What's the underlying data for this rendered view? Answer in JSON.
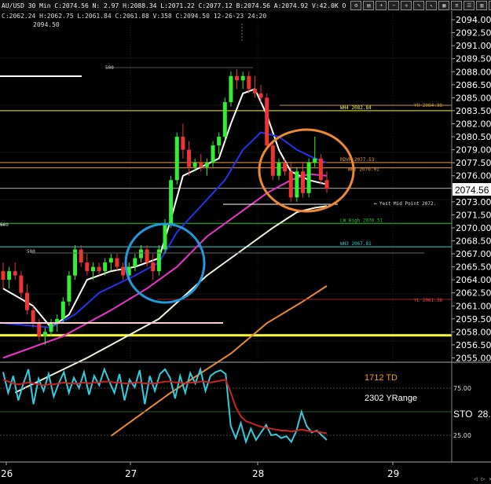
{
  "header": {
    "info": "AU/USD 30 Min C:2074.56 N: 2.97 H:2088.34 L:2071.22 C:2077.12 B:2074.56 A:2074.92 V:42.0K O",
    "subinfo": "C:2062.24 H:2062.75 L:2061.84 C:2061.88 V:358 C:2094.50 12-26-23 24:20",
    "sub_value": "2094.50",
    "icons": [
      "settings-icon",
      "chart-type-icon",
      "zoom-in-icon",
      "zoom-out-icon",
      "crosshair-icon",
      "draw-icon",
      "cursor-icon",
      "grid-icon",
      "config-icon",
      "list-icon",
      "layout-icon",
      "window-icon"
    ]
  },
  "chart_data": [
    {
      "type": "candlestick",
      "ylim": [
        2054.5,
        2095.0
      ],
      "y_ticks": [
        "2094.00",
        "2092.50",
        "2091.00",
        "2089.50",
        "2088.00",
        "2086.50",
        "2085.00",
        "2083.50",
        "2082.00",
        "2080.50",
        "2079.00",
        "2077.50",
        "2076.00",
        "2074.56",
        "2073.00",
        "2071.50",
        "2070.00",
        "2068.50",
        "2067.00",
        "2065.50",
        "2064.00",
        "2062.50",
        "2061.00",
        "2059.50",
        "2058.00",
        "2056.50",
        "2055.00"
      ],
      "last_price": "2074.56",
      "x_ticks": [
        "26",
        "27",
        "28",
        "29"
      ],
      "candles": [
        [
          2065,
          2066,
          2063,
          2064
        ],
        [
          2064,
          2065.5,
          2063,
          2065
        ],
        [
          2065,
          2066,
          2064,
          2064.5
        ],
        [
          2064.5,
          2065,
          2062,
          2062.5
        ],
        [
          2062.5,
          2063.5,
          2060,
          2060.5
        ],
        [
          2060.5,
          2061,
          2058.5,
          2059
        ],
        [
          2059,
          2059.5,
          2057,
          2057.5
        ],
        [
          2057.5,
          2058.5,
          2056.5,
          2058
        ],
        [
          2058,
          2059.5,
          2057.5,
          2059
        ],
        [
          2059,
          2060,
          2058,
          2059.5
        ],
        [
          2059.5,
          2062,
          2059,
          2061.5
        ],
        [
          2061.5,
          2065,
          2061,
          2064.5
        ],
        [
          2064.5,
          2068,
          2064,
          2067.5
        ],
        [
          2067.5,
          2068,
          2065.5,
          2066
        ],
        [
          2066,
          2067,
          2064.5,
          2065
        ],
        [
          2065,
          2066,
          2064,
          2065.5
        ],
        [
          2065.5,
          2066,
          2064.5,
          2065
        ],
        [
          2065,
          2066.5,
          2064.5,
          2066
        ],
        [
          2066,
          2067,
          2065,
          2066.5
        ],
        [
          2066.5,
          2067,
          2065,
          2065.5
        ],
        [
          2065.5,
          2066,
          2064,
          2064.5
        ],
        [
          2064.5,
          2066,
          2064,
          2065.5
        ],
        [
          2065.5,
          2067,
          2065,
          2066.5
        ],
        [
          2066.5,
          2068,
          2066,
          2067.5
        ],
        [
          2067.5,
          2068,
          2065.5,
          2066
        ],
        [
          2066,
          2067,
          2064,
          2065
        ],
        [
          2065,
          2068,
          2064.5,
          2067.5
        ],
        [
          2067.5,
          2071,
          2067,
          2070.5
        ],
        [
          2070.5,
          2076,
          2070,
          2075.5
        ],
        [
          2075.5,
          2081,
          2075,
          2080.5
        ],
        [
          2080.5,
          2082,
          2078,
          2079
        ],
        [
          2079,
          2080,
          2076,
          2077
        ],
        [
          2077,
          2078,
          2076.5,
          2077.5
        ],
        [
          2077.5,
          2078.5,
          2076.5,
          2077
        ],
        [
          2077,
          2078,
          2076,
          2077.5
        ],
        [
          2077.5,
          2080,
          2077,
          2079.5
        ],
        [
          2079.5,
          2081,
          2078.5,
          2080.5
        ],
        [
          2080.5,
          2085,
          2080,
          2084.5
        ],
        [
          2084.5,
          2088,
          2084,
          2087.5
        ],
        [
          2087.5,
          2088.3,
          2086,
          2087
        ],
        [
          2087,
          2088,
          2086,
          2087.5
        ],
        [
          2087.5,
          2088,
          2085.5,
          2086
        ],
        [
          2086,
          2087.5,
          2085,
          2085.5
        ],
        [
          2085.5,
          2086.5,
          2084.5,
          2085
        ],
        [
          2085,
          2085.5,
          2079,
          2079.5
        ],
        [
          2079.5,
          2080,
          2075.5,
          2076
        ],
        [
          2076,
          2078,
          2075.5,
          2077.5
        ],
        [
          2077.5,
          2078,
          2076,
          2076.5
        ],
        [
          2076.5,
          2077.5,
          2073,
          2073.5
        ],
        [
          2073.5,
          2077,
          2073,
          2076.5
        ],
        [
          2076.5,
          2077.5,
          2073.5,
          2074
        ],
        [
          2074,
          2078,
          2073.5,
          2077.5
        ],
        [
          2077.5,
          2080.5,
          2077,
          2078
        ],
        [
          2078,
          2078.5,
          2075,
          2075.5
        ],
        [
          2075.5,
          2076.5,
          2074,
          2074.5
        ]
      ],
      "ma_lines": [
        {
          "color": "#ffffff",
          "points": [
            [
              0,
              2063
            ],
            [
              5,
              2061
            ],
            [
              8,
              2058.5
            ],
            [
              11,
              2060
            ],
            [
              14,
              2064
            ],
            [
              18,
              2065
            ],
            [
              22,
              2065.5
            ],
            [
              26,
              2066.5
            ],
            [
              28,
              2071
            ],
            [
              30,
              2076
            ],
            [
              33,
              2077
            ],
            [
              36,
              2078
            ],
            [
              38,
              2082
            ],
            [
              40,
              2085.5
            ],
            [
              42,
              2086
            ],
            [
              44,
              2083
            ],
            [
              46,
              2079
            ],
            [
              48,
              2076.5
            ],
            [
              51,
              2075.5
            ],
            [
              54,
              2075
            ]
          ]
        },
        {
          "color": "#2233ee",
          "points": [
            [
              0,
              2059
            ],
            [
              8,
              2058.5
            ],
            [
              12,
              2060
            ],
            [
              16,
              2062.5
            ],
            [
              22,
              2064.5
            ],
            [
              26,
              2066
            ],
            [
              29,
              2069.5
            ],
            [
              33,
              2072.5
            ],
            [
              37,
              2075.5
            ],
            [
              40,
              2079
            ],
            [
              43,
              2081
            ],
            [
              46,
              2080.5
            ],
            [
              49,
              2079
            ],
            [
              52,
              2078
            ],
            [
              54,
              2077.5
            ]
          ]
        },
        {
          "color": "#ee33cc",
          "points": [
            [
              0,
              2055
            ],
            [
              10,
              2057.5
            ],
            [
              18,
              2060.5
            ],
            [
              24,
              2063
            ],
            [
              29,
              2065.5
            ],
            [
              34,
              2069
            ],
            [
              39,
              2071.5
            ],
            [
              44,
              2074
            ],
            [
              48,
              2075.5
            ],
            [
              51,
              2076.2
            ],
            [
              54,
              2076
            ]
          ]
        },
        {
          "color": "#f4f4dd",
          "points": [
            [
              2,
              2051
            ],
            [
              14,
              2055
            ],
            [
              26,
              2059.5
            ],
            [
              34,
              2064.5
            ],
            [
              40,
              2067.5
            ],
            [
              45,
              2070
            ],
            [
              49,
              2071.8
            ],
            [
              52,
              2072.3
            ],
            [
              54,
              2072.5
            ]
          ]
        },
        {
          "color": "#ee8833",
          "points": [
            [
              18,
              2046
            ],
            [
              28,
              2051
            ],
            [
              38,
              2055.5
            ],
            [
              44,
              2059
            ],
            [
              50,
              2061.5
            ],
            [
              54,
              2063.3
            ]
          ]
        }
      ],
      "h_levels": [
        {
          "y": 2083.5,
          "color": "#eeee44",
          "label": "WH4 2082.84"
        },
        {
          "y": 2077.53,
          "color": "#ee9933",
          "label": "RDVR 2077.53"
        },
        {
          "y": 2076.91,
          "color": "#ee9933",
          "label": "WRT 2076.91"
        },
        {
          "y": 2074.56,
          "color": "#aaaaaa",
          "label": ""
        },
        {
          "y": 2070.51,
          "color": "#22cc22",
          "label": "LW High 2070.51"
        },
        {
          "y": 2067.81,
          "color": "#33cccc",
          "label": "WH3 2067.81"
        },
        {
          "y": 2057.6,
          "color": "#ffff33",
          "label": ""
        }
      ],
      "annotations": {
        "yh": "YH 2084.38",
        "yl": "YL 2061.36",
        "yest_mid": "Yest Mid Point 2072.",
        "l500a": "500",
        "l500b": "500",
        "l500c": "500"
      }
    },
    {
      "type": "line",
      "title": "STO",
      "ylim": [
        0,
        100
      ],
      "y_ticks": [
        "75.00",
        "25.00"
      ],
      "value_label": "28.",
      "annotations": [
        "1712 TD",
        "2302 YRange"
      ],
      "series": [
        {
          "color": "#33ccdd",
          "values": [
            92,
            70,
            88,
            62,
            80,
            95,
            58,
            85,
            72,
            90,
            66,
            80,
            92,
            70,
            86,
            75,
            92,
            68,
            88,
            78,
            95,
            82,
            70,
            90,
            62,
            84,
            76,
            94,
            58,
            88,
            72,
            90,
            95,
            86,
            64,
            88,
            70,
            91,
            80,
            95,
            72,
            88,
            92,
            94,
            90,
            35,
            22,
            38,
            18,
            32,
            20,
            28,
            36,
            25,
            26,
            22,
            24,
            18,
            30,
            50,
            35,
            28,
            30,
            25,
            20
          ]
        },
        {
          "color": "#cc2222",
          "values": [
            84,
            82,
            80,
            79,
            80,
            81,
            80,
            79,
            78,
            79,
            79,
            80,
            81,
            80,
            80,
            80,
            81,
            80,
            81,
            81,
            82,
            82,
            81,
            81,
            80,
            80,
            81,
            81,
            80,
            80,
            80,
            81,
            82,
            82,
            81,
            81,
            80,
            81,
            81,
            82,
            82,
            81,
            82,
            83,
            84,
            70,
            55,
            45,
            40,
            38,
            36,
            34,
            33,
            32,
            31,
            30,
            30,
            29,
            30,
            31,
            30,
            29,
            29,
            28,
            27
          ]
        }
      ]
    }
  ]
}
